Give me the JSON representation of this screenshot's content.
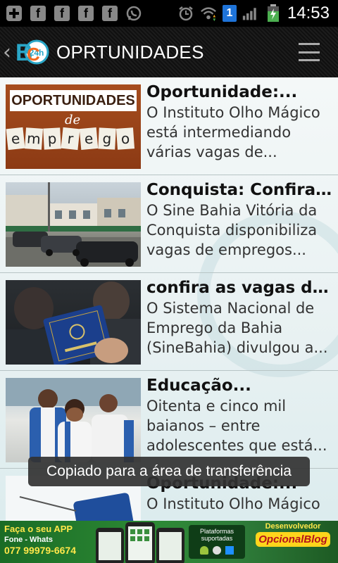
{
  "status_bar": {
    "time": "14:53",
    "notification_count": "1",
    "icons": [
      "plus-icon",
      "facebook-icon",
      "facebook-icon",
      "facebook-icon",
      "facebook-icon",
      "whatsapp-icon",
      "alarm-icon",
      "wifi-icon",
      "signal-icon",
      "battery-icon"
    ]
  },
  "action_bar": {
    "title": "OPRTUNIDADES",
    "logo_icon": "bc24h-logo-icon",
    "menu_icon": "hamburger-menu-icon"
  },
  "articles": [
    {
      "title": "Oportunidade:...",
      "description": "O Instituto Olho Mágico está intermediando várias vagas de...",
      "thumb_text_top": "OPORTUNIDADES",
      "thumb_text_mid": "de",
      "thumb_letters": [
        "e",
        "m",
        "p",
        "r",
        "e",
        "g",
        "o"
      ]
    },
    {
      "title": "Conquista: Confira ...",
      "description": "O Sine Bahia Vitória da Conquista disponibiliza vagas de empregos..."
    },
    {
      "title": "confira as vagas do...",
      "description": "O Sistema Nacional de Emprego da Bahia (SineBahia) divulgou a..."
    },
    {
      "title": "Educação...",
      "description": "Oitenta e cinco mil baianos – entre adolescentes que está..."
    },
    {
      "title": "Oportunidade:...",
      "description": "O Instituto Olho Mágico"
    }
  ],
  "toast": {
    "text": "Copiado para a área de transferência"
  },
  "banner": {
    "line1": "Faça o seu APP",
    "line2": "Fone - Whats",
    "line3": "077 99979-6674",
    "platforms_label": "Plataformas suportadas",
    "developer_label": "Desenvolvedor",
    "developer_brand": "OpcionalBlog"
  },
  "colors": {
    "status_bar_bg": "#000000",
    "action_bar_bg": "#161616",
    "list_bg": "#eef5f5",
    "banner_green": "#2d8a35",
    "accent_yellow": "#ffe74a",
    "toast_bg": "#323232"
  }
}
